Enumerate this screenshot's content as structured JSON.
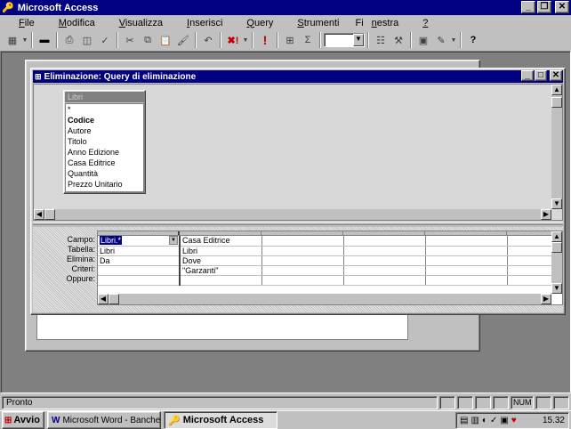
{
  "app": {
    "title": "Microsoft Access"
  },
  "menu": [
    {
      "pre": "",
      "u": "F",
      "post": "ile"
    },
    {
      "pre": "",
      "u": "M",
      "post": "odifica"
    },
    {
      "pre": "",
      "u": "V",
      "post": "isualizza"
    },
    {
      "pre": "",
      "u": "I",
      "post": "nserisci"
    },
    {
      "pre": "",
      "u": "Q",
      "post": "uery"
    },
    {
      "pre": "",
      "u": "S",
      "post": "trumenti"
    },
    {
      "pre": "Fi",
      "u": "n",
      "post": "estra"
    },
    {
      "pre": "",
      "u": "?",
      "post": ""
    }
  ],
  "query_window": {
    "title": "Eliminazione: Query di eliminazione"
  },
  "table_box": {
    "title": "Libri",
    "fields": [
      "*",
      "Codice",
      "Autore",
      "Titolo",
      "Anno Edizione",
      "Casa Editrice",
      "Quantità",
      "Prezzo Unitario"
    ],
    "primary_key": "Codice"
  },
  "grid": {
    "row_labels": [
      "Campo:",
      "Tabella:",
      "Elimina:",
      "Criteri:",
      "Oppure:"
    ],
    "columns": [
      {
        "campo": "Libri.*",
        "tabella": "Libri",
        "elimina": "Da",
        "criteri": ""
      },
      {
        "campo": "Casa Editrice",
        "tabella": "Libri",
        "elimina": "Dove",
        "criteri": "\"Garzanti\""
      }
    ]
  },
  "status": {
    "text": "Pronto",
    "num": "NUM"
  },
  "taskbar": {
    "start": "Avvio",
    "tasks": [
      "Microsoft Word - Banche d...",
      "Microsoft Access"
    ],
    "clock": "15.32"
  },
  "colors": {
    "titlebar": "#000080",
    "desktop": "#c0c0c0",
    "mdi": "#808080"
  }
}
